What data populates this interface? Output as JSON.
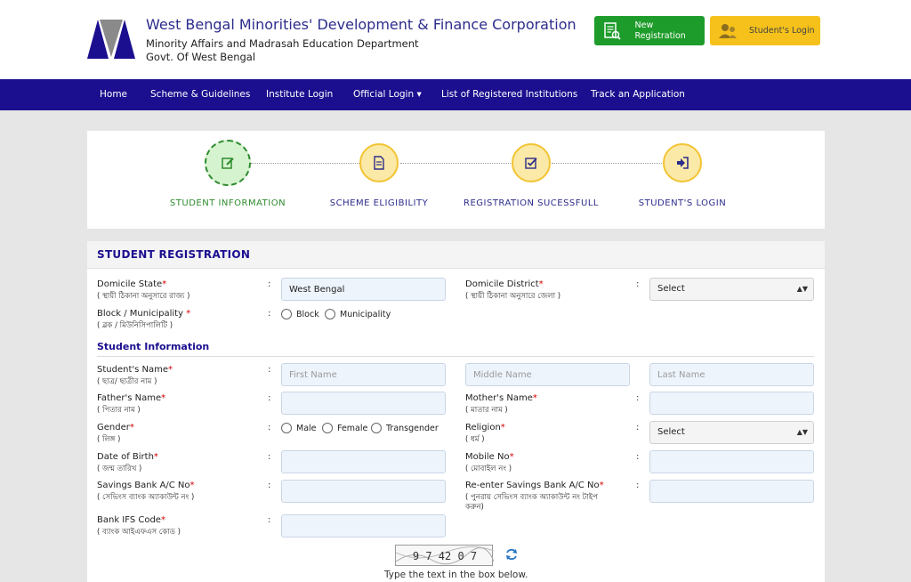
{
  "header": {
    "title": "West Bengal Minorities' Development & Finance Corporation",
    "subtitle1": "Minority Affairs and Madrasah Education Department",
    "subtitle2": "Govt. Of West Bengal",
    "new_registration": "New Registration",
    "student_login": "Student's Login"
  },
  "nav": [
    "Home",
    "Scheme & Guidelines",
    "Institute Login",
    "Official Login ▾",
    "List of Registered Institutions",
    "Track an Application"
  ],
  "steps": [
    {
      "label": "STUDENT INFORMATION",
      "icon": "edit-icon"
    },
    {
      "label": "SCHEME ELIGIBILITY",
      "icon": "document-icon"
    },
    {
      "label": "REGISTRATION SUCESSFULL",
      "icon": "checkbox-icon"
    },
    {
      "label": "STUDENT'S LOGIN",
      "icon": "sign-in-icon"
    }
  ],
  "form": {
    "title": "STUDENT REGISTRATION",
    "section_student": "Student Information",
    "domicile_state": {
      "label": "Domicile State",
      "bn": "( স্থায়ী ঠিকানা অনুসারে রাজ্য )",
      "value": "West Bengal"
    },
    "domicile_district": {
      "label": "Domicile District",
      "bn": "( স্থায়ী ঠিকানা অনুসারে জেলা )",
      "value": "Select"
    },
    "block_municipality": {
      "label": "Block / Municipality ",
      "bn": "( ব্লক / মিউনিসিপালিটি )",
      "options": [
        "Block",
        "Municipality"
      ]
    },
    "student_name": {
      "label": "Student's Name",
      "bn": "( ছাত্র/ ছাত্রীর নাম )",
      "first": "First Name",
      "middle": "Middle Name",
      "last": "Last Name"
    },
    "father_name": {
      "label": "Father's Name",
      "bn": "( পিতার নাম )"
    },
    "mother_name": {
      "label": "Mother's Name",
      "bn": "( মাতার নাম )"
    },
    "gender": {
      "label": "Gender",
      "bn": "( লিঙ্গ )",
      "options": [
        "Male",
        "Female",
        "Transgender"
      ]
    },
    "religion": {
      "label": "Religion",
      "bn": "( ধর্ম )",
      "value": "Select"
    },
    "dob": {
      "label": "Date of Birth",
      "bn": "( জন্ম তারিখ )"
    },
    "mobile": {
      "label": "Mobile No",
      "bn": "( মোবাইল নং )"
    },
    "savings": {
      "label": "Savings Bank A/C No",
      "bn": "( সেভিংস ব্যাংক অ্যাকাউন্ট নং )"
    },
    "reenter_savings": {
      "label": "Re-enter Savings Bank A/C No",
      "bn1": "( পুনরায় সেভিংস ব্যাংক অ্যাকাউন্ট নং টাইপ",
      "bn2": "করুন)"
    },
    "ifsc": {
      "label": "Bank IFS Code",
      "bn": "( ব্যাংক আইএফএস কোড )"
    },
    "captcha_text": "9 7 42 0 7",
    "captcha_hint": "Type the text in the box below."
  },
  "colors": {
    "nav": "#1b0f8f",
    "new_btn": "#1e9c2b",
    "login_btn": "#f5c11a",
    "active_step": "#2e8b2e"
  }
}
